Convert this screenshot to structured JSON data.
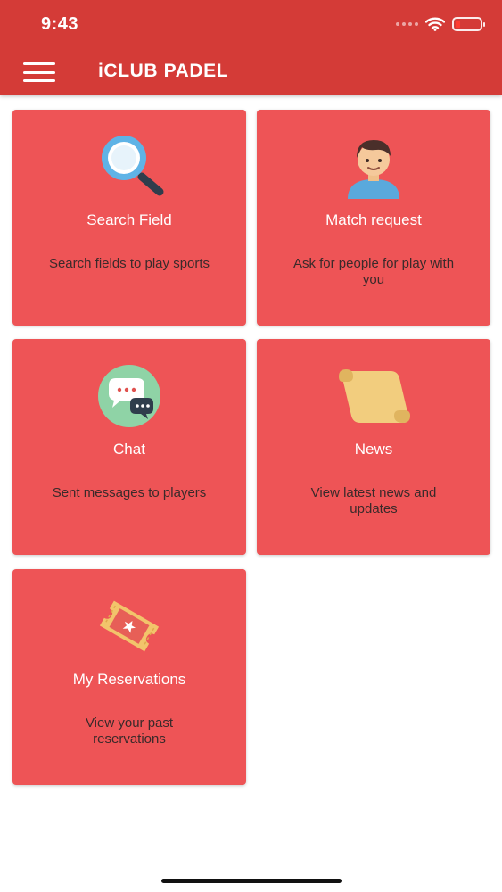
{
  "status_bar": {
    "time": "9:43"
  },
  "header": {
    "title": "iCLUB PADEL",
    "menu_icon": "hamburger-menu-icon"
  },
  "colors": {
    "header": "#d43b37",
    "card": "#ee5456",
    "title_text": "#ffffff",
    "desc_text": "#3a2a2a"
  },
  "cards": [
    {
      "icon": "magnifier-icon",
      "title": "Search Field",
      "description": "Search fields to play sports"
    },
    {
      "icon": "person-avatar-icon",
      "title": "Match request",
      "description": "Ask for people for play with you"
    },
    {
      "icon": "chat-bubbles-icon",
      "title": "Chat",
      "description": "Sent messages to players"
    },
    {
      "icon": "scroll-icon",
      "title": "News",
      "description": "View latest news and updates"
    },
    {
      "icon": "ticket-icon",
      "title": "My Reservations",
      "description": "View your past reservations"
    }
  ]
}
